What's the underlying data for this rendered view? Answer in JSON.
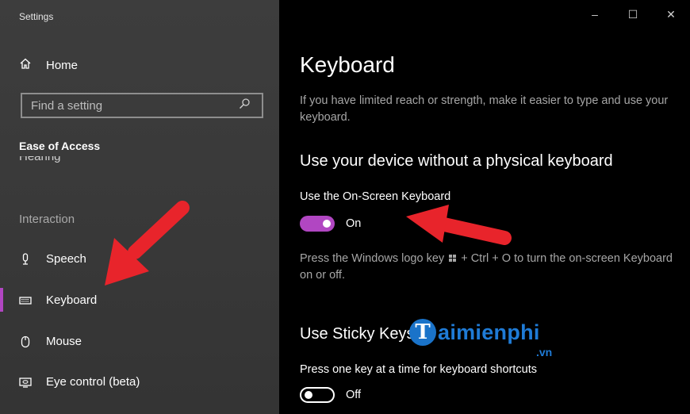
{
  "window": {
    "title": "Settings",
    "controls": {
      "minimize": "–",
      "maximize": "☐",
      "close": "✕"
    }
  },
  "sidebar": {
    "home_label": "Home",
    "search": {
      "placeholder": "Find a setting"
    },
    "section_title": "Ease of Access",
    "cut_item": "Hearing",
    "group_label": "Interaction",
    "items": [
      {
        "label": "Speech",
        "icon": "microphone-icon"
      },
      {
        "label": "Keyboard",
        "icon": "keyboard-icon",
        "active": true
      },
      {
        "label": "Mouse",
        "icon": "mouse-icon"
      },
      {
        "label": "Eye control (beta)",
        "icon": "eye-control-icon"
      }
    ]
  },
  "main": {
    "title": "Keyboard",
    "description": "If you have limited reach or strength, make it easier to type and use your keyboard.",
    "section1": {
      "heading": "Use your device without a physical keyboard",
      "toggle_label": "Use the On-Screen Keyboard",
      "toggle_state": "On",
      "hint_before": "Press the Windows logo key",
      "hint_after": "+ Ctrl + O to turn the on-screen Keyboard on or off."
    },
    "section2": {
      "heading": "Use Sticky Keys",
      "toggle_label": "Press one key at a time for keyboard shortcuts",
      "toggle_state": "Off"
    }
  },
  "watermark": {
    "badge": "T",
    "text": "aimienphi",
    "sub": ".vn"
  },
  "colors": {
    "accent": "#b146c2",
    "arrow": "#e8242b",
    "sidebar_bg": "#3a3a3a",
    "main_bg": "#000000"
  }
}
